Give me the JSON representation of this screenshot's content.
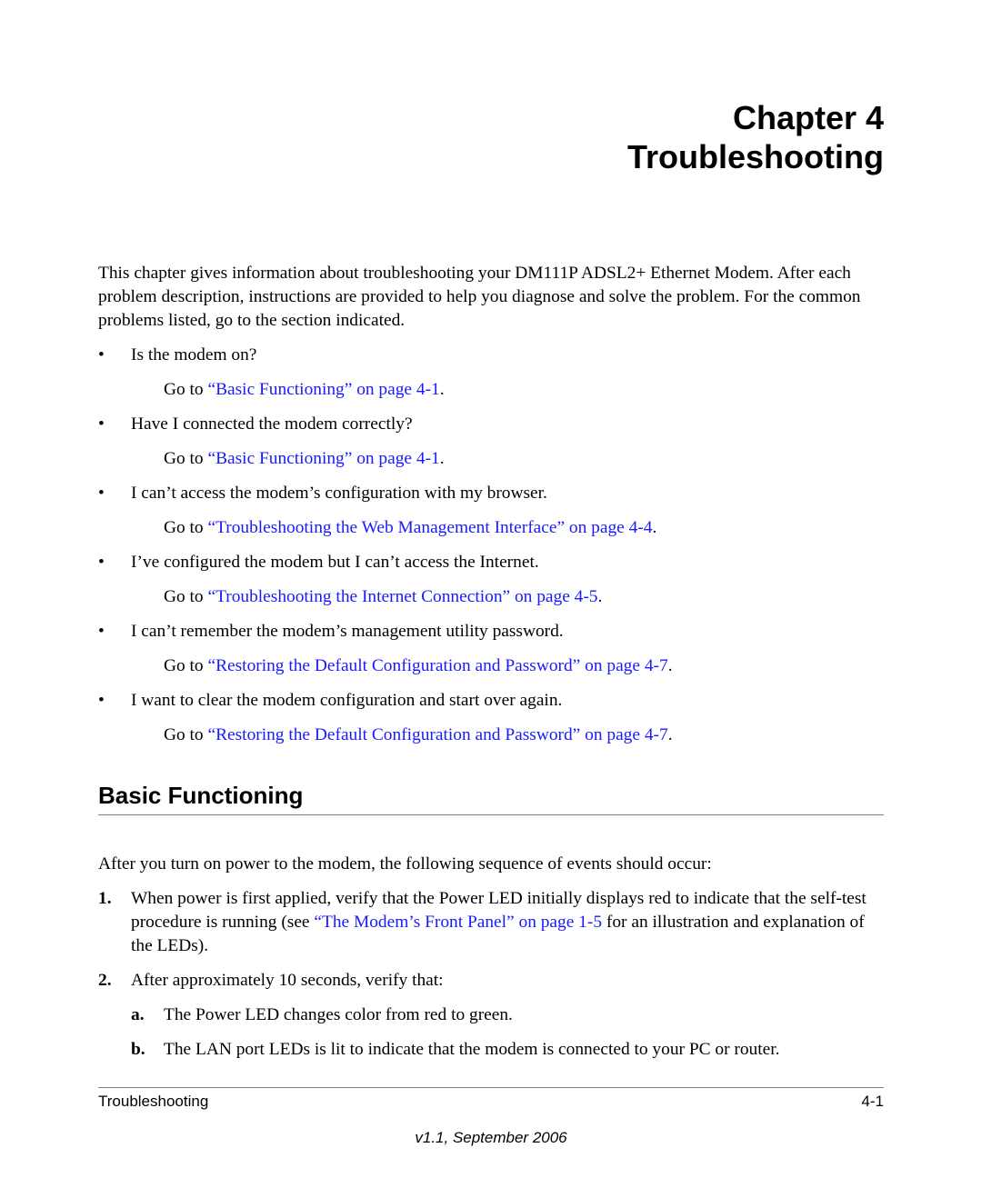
{
  "chapter": {
    "label": "Chapter 4",
    "title": "Troubleshooting"
  },
  "intro": "This chapter gives information about troubleshooting your DM111P ADSL2+ Ethernet Modem. After each problem description, instructions are provided to help you diagnose and solve the problem. For the common problems listed, go to the section indicated.",
  "problems": [
    {
      "bullet": "•",
      "question": "Is the modem on?",
      "goto_prefix": "Go to ",
      "link": "“Basic Functioning” on page 4-1",
      "goto_suffix": "."
    },
    {
      "bullet": "•",
      "question": "Have I connected the modem correctly?",
      "goto_prefix": "Go to ",
      "link": "“Basic Functioning” on page 4-1",
      "goto_suffix": "."
    },
    {
      "bullet": "•",
      "question": "I can’t access the modem’s configuration with my browser.",
      "goto_prefix": "Go to ",
      "link": "“Troubleshooting the Web Management Interface” on page 4-4",
      "goto_suffix": "."
    },
    {
      "bullet": "•",
      "question": "I’ve configured the modem but I can’t access the Internet.",
      "goto_prefix": "Go to ",
      "link": "“Troubleshooting the Internet Connection” on page 4-5",
      "goto_suffix": "."
    },
    {
      "bullet": "•",
      "question": "I can’t remember the modem’s management utility password.",
      "goto_prefix": "Go to ",
      "link": "“Restoring the Default Configuration and Password” on page 4-7",
      "goto_suffix": "."
    },
    {
      "bullet": "•",
      "question": "I want to clear the modem configuration and start over again.",
      "goto_prefix": "Go to ",
      "link": "“Restoring the Default Configuration and Password” on page 4-7",
      "goto_suffix": "."
    }
  ],
  "section": {
    "title": "Basic Functioning",
    "lead": "After you turn on power to the modem, the following sequence of events should occur:",
    "steps": [
      {
        "num": "1.",
        "text_before": "When power is first applied, verify that the Power LED initially displays red to indicate that the self-test procedure is running (see ",
        "link": "“The Modem’s Front Panel” on page 1-5",
        "text_after": " for an illustration and explanation of the LEDs)."
      },
      {
        "num": "2.",
        "text": "After approximately 10 seconds, verify that:",
        "substeps": [
          {
            "letter": "a.",
            "text": "The Power LED changes color from red to green."
          },
          {
            "letter": "b.",
            "text": "The LAN port LEDs is lit to indicate that the modem is connected to your PC or router."
          }
        ]
      }
    ]
  },
  "footer": {
    "left": "Troubleshooting",
    "right": "4-1",
    "version": "v1.1, September 2006"
  },
  "colors": {
    "link": "#1a1aff",
    "rule": "#808080"
  }
}
